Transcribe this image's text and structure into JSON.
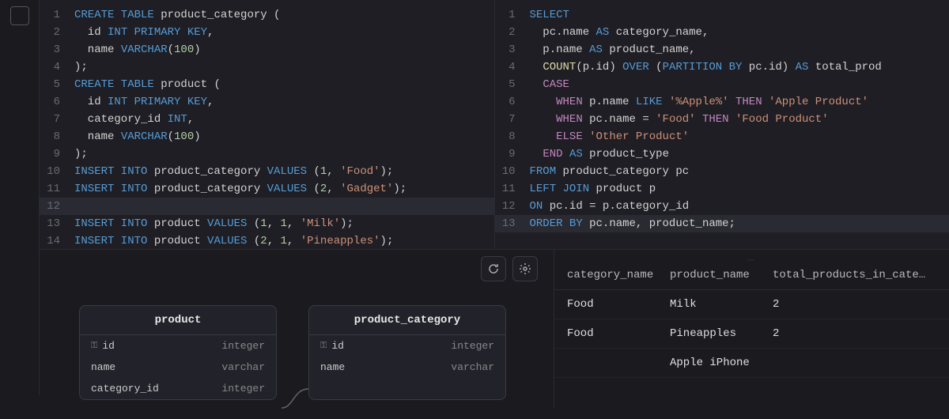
{
  "editor_left": {
    "lines": [
      {
        "n": 1,
        "tokens": [
          [
            "kw",
            "CREATE TABLE"
          ],
          [
            "id",
            " product_category ("
          ]
        ]
      },
      {
        "n": 2,
        "tokens": [
          [
            "id",
            "  id "
          ],
          [
            "kw",
            "INT PRIMARY KEY"
          ],
          [
            "id",
            ","
          ]
        ]
      },
      {
        "n": 3,
        "tokens": [
          [
            "id",
            "  name "
          ],
          [
            "kw",
            "VARCHAR"
          ],
          [
            "id",
            "("
          ],
          [
            "num",
            "100"
          ],
          [
            "id",
            ")"
          ]
        ]
      },
      {
        "n": 4,
        "tokens": [
          [
            "id",
            ");"
          ]
        ]
      },
      {
        "n": 5,
        "tokens": [
          [
            "kw",
            "CREATE TABLE"
          ],
          [
            "id",
            " product ("
          ]
        ]
      },
      {
        "n": 6,
        "tokens": [
          [
            "id",
            "  id "
          ],
          [
            "kw",
            "INT PRIMARY KEY"
          ],
          [
            "id",
            ","
          ]
        ]
      },
      {
        "n": 7,
        "tokens": [
          [
            "id",
            "  category_id "
          ],
          [
            "kw",
            "INT"
          ],
          [
            "id",
            ","
          ]
        ]
      },
      {
        "n": 8,
        "tokens": [
          [
            "id",
            "  name "
          ],
          [
            "kw",
            "VARCHAR"
          ],
          [
            "id",
            "("
          ],
          [
            "num",
            "100"
          ],
          [
            "id",
            ")"
          ]
        ]
      },
      {
        "n": 9,
        "tokens": [
          [
            "id",
            ");"
          ]
        ]
      },
      {
        "n": 10,
        "tokens": [
          [
            "kw",
            "INSERT INTO"
          ],
          [
            "id",
            " product_category "
          ],
          [
            "kw",
            "VALUES"
          ],
          [
            "id",
            " ("
          ],
          [
            "num",
            "1"
          ],
          [
            "id",
            ", "
          ],
          [
            "str",
            "'Food'"
          ],
          [
            "id",
            ");"
          ]
        ]
      },
      {
        "n": 11,
        "tokens": [
          [
            "kw",
            "INSERT INTO"
          ],
          [
            "id",
            " product_category "
          ],
          [
            "kw",
            "VALUES"
          ],
          [
            "id",
            " ("
          ],
          [
            "num",
            "2"
          ],
          [
            "id",
            ", "
          ],
          [
            "str",
            "'Gadget'"
          ],
          [
            "id",
            ");"
          ]
        ]
      },
      {
        "n": 12,
        "tokens": [],
        "active": true
      },
      {
        "n": 13,
        "tokens": [
          [
            "kw",
            "INSERT INTO"
          ],
          [
            "id",
            " product "
          ],
          [
            "kw",
            "VALUES"
          ],
          [
            "id",
            " ("
          ],
          [
            "num",
            "1"
          ],
          [
            "id",
            ", "
          ],
          [
            "num",
            "1"
          ],
          [
            "id",
            ", "
          ],
          [
            "str",
            "'Milk'"
          ],
          [
            "id",
            ");"
          ]
        ]
      },
      {
        "n": 14,
        "tokens": [
          [
            "kw",
            "INSERT INTO"
          ],
          [
            "id",
            " product "
          ],
          [
            "kw",
            "VALUES"
          ],
          [
            "id",
            " ("
          ],
          [
            "num",
            "2"
          ],
          [
            "id",
            ", "
          ],
          [
            "num",
            "1"
          ],
          [
            "id",
            ", "
          ],
          [
            "str",
            "'Pineapples'"
          ],
          [
            "id",
            ");"
          ]
        ]
      }
    ]
  },
  "editor_right": {
    "lines": [
      {
        "n": 1,
        "tokens": [
          [
            "kw",
            "SELECT"
          ]
        ]
      },
      {
        "n": 2,
        "tokens": [
          [
            "id",
            "  pc.name "
          ],
          [
            "kw",
            "AS"
          ],
          [
            "id",
            " category_name,"
          ]
        ]
      },
      {
        "n": 3,
        "tokens": [
          [
            "id",
            "  p.name "
          ],
          [
            "kw",
            "AS"
          ],
          [
            "id",
            " product_name,"
          ]
        ]
      },
      {
        "n": 4,
        "tokens": [
          [
            "id",
            "  "
          ],
          [
            "fn",
            "COUNT"
          ],
          [
            "id",
            "(p.id) "
          ],
          [
            "kw",
            "OVER"
          ],
          [
            "id",
            " ("
          ],
          [
            "kw",
            "PARTITION BY"
          ],
          [
            "id",
            " pc.id) "
          ],
          [
            "kw",
            "AS"
          ],
          [
            "id",
            " total_prod"
          ]
        ]
      },
      {
        "n": 5,
        "tokens": [
          [
            "id",
            "  "
          ],
          [
            "kw2",
            "CASE"
          ]
        ]
      },
      {
        "n": 6,
        "tokens": [
          [
            "id",
            "    "
          ],
          [
            "kw2",
            "WHEN"
          ],
          [
            "id",
            " p.name "
          ],
          [
            "kw",
            "LIKE"
          ],
          [
            "id",
            " "
          ],
          [
            "str",
            "'%Apple%'"
          ],
          [
            "id",
            " "
          ],
          [
            "kw2",
            "THEN"
          ],
          [
            "id",
            " "
          ],
          [
            "str",
            "'Apple Product'"
          ]
        ]
      },
      {
        "n": 7,
        "tokens": [
          [
            "id",
            "    "
          ],
          [
            "kw2",
            "WHEN"
          ],
          [
            "id",
            " pc.name = "
          ],
          [
            "str",
            "'Food'"
          ],
          [
            "id",
            " "
          ],
          [
            "kw2",
            "THEN"
          ],
          [
            "id",
            " "
          ],
          [
            "str",
            "'Food Product'"
          ]
        ]
      },
      {
        "n": 8,
        "tokens": [
          [
            "id",
            "    "
          ],
          [
            "kw2",
            "ELSE"
          ],
          [
            "id",
            " "
          ],
          [
            "str",
            "'Other Product'"
          ]
        ]
      },
      {
        "n": 9,
        "tokens": [
          [
            "id",
            "  "
          ],
          [
            "kw2",
            "END"
          ],
          [
            "id",
            " "
          ],
          [
            "kw",
            "AS"
          ],
          [
            "id",
            " product_type"
          ]
        ]
      },
      {
        "n": 10,
        "tokens": [
          [
            "kw",
            "FROM"
          ],
          [
            "id",
            " product_category pc"
          ]
        ]
      },
      {
        "n": 11,
        "tokens": [
          [
            "kw",
            "LEFT JOIN"
          ],
          [
            "id",
            " product p"
          ]
        ]
      },
      {
        "n": 12,
        "tokens": [
          [
            "kw",
            "ON"
          ],
          [
            "id",
            " pc.id = p.category_id"
          ]
        ]
      },
      {
        "n": 13,
        "tokens": [
          [
            "kw",
            "ORDER BY"
          ],
          [
            "id",
            " pc.name, product_name;"
          ]
        ],
        "active": true
      }
    ]
  },
  "schema": {
    "product": {
      "title": "product",
      "cols": [
        {
          "name": "id",
          "type": "integer",
          "pk": true
        },
        {
          "name": "name",
          "type": "varchar",
          "pk": false
        },
        {
          "name": "category_id",
          "type": "integer",
          "pk": false
        }
      ]
    },
    "product_category": {
      "title": "product_category",
      "cols": [
        {
          "name": "id",
          "type": "integer",
          "pk": true
        },
        {
          "name": "name",
          "type": "varchar",
          "pk": false
        }
      ]
    }
  },
  "results": {
    "headers": [
      "category_name",
      "product_name",
      "total_products_in_category"
    ],
    "rows": [
      [
        "Food",
        "Milk",
        "2"
      ],
      [
        "Food",
        "Pineapples",
        "2"
      ],
      [
        "",
        "Apple iPhone",
        ""
      ]
    ]
  }
}
